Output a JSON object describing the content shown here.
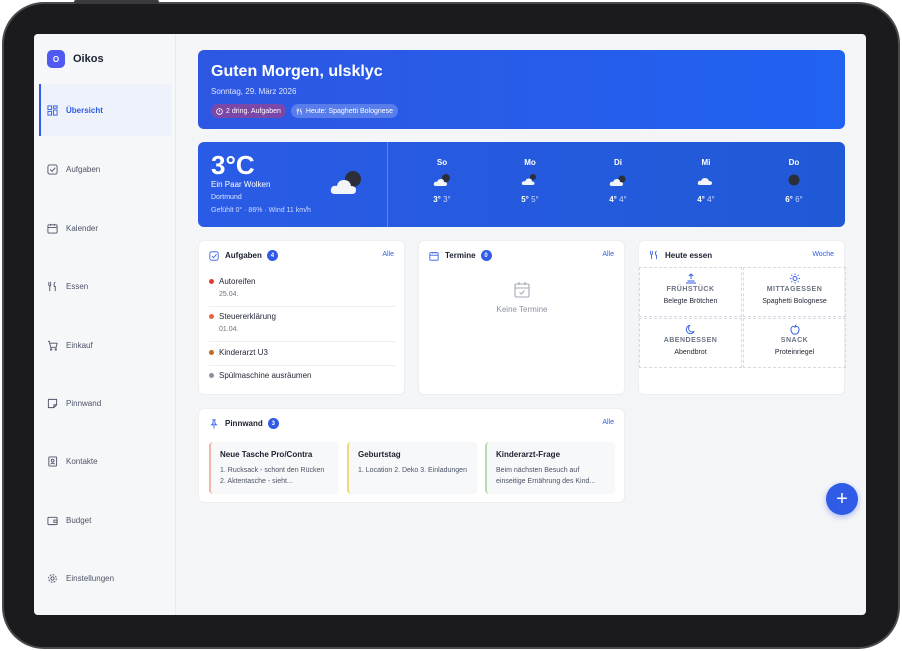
{
  "app": {
    "name": "Oikos",
    "logo_letter": "O"
  },
  "sidebar": {
    "items": [
      {
        "label": "Übersicht",
        "icon": "dashboard-icon",
        "active": true
      },
      {
        "label": "Aufgaben",
        "icon": "checkbox-icon"
      },
      {
        "label": "Kalender",
        "icon": "calendar-icon"
      },
      {
        "label": "Essen",
        "icon": "cutlery-icon"
      },
      {
        "label": "Einkauf",
        "icon": "cart-icon"
      },
      {
        "label": "Pinnwand",
        "icon": "sticky-note-icon"
      },
      {
        "label": "Kontakte",
        "icon": "contacts-icon"
      },
      {
        "label": "Budget",
        "icon": "wallet-icon"
      },
      {
        "label": "Einstellungen",
        "icon": "gear-icon"
      }
    ]
  },
  "hero": {
    "greeting": "Guten Morgen, ulsklyc",
    "date": "Sonntag, 29. März 2026",
    "urgent_chip": "2 dring. Aufgaben",
    "food_chip": "Heute: Spaghetti Bolognese"
  },
  "weather": {
    "temp": "3°C",
    "description": "Ein Paar Wolken",
    "location": "Dortmund",
    "details": "Gefühlt 0° · 86% · Wind 11 km/h",
    "forecast": [
      {
        "day": "So",
        "hi": "3°",
        "lo": "3°",
        "icon": "cloud-night-icon"
      },
      {
        "day": "Mo",
        "hi": "5°",
        "lo": "5°",
        "icon": "cloud-night-icon"
      },
      {
        "day": "Di",
        "hi": "4°",
        "lo": "4°",
        "icon": "cloud-night-icon"
      },
      {
        "day": "Mi",
        "hi": "4°",
        "lo": "4°",
        "icon": "cloud-icon"
      },
      {
        "day": "Do",
        "hi": "6°",
        "lo": "6°",
        "icon": "moon-icon"
      }
    ]
  },
  "tasks": {
    "title": "Aufgaben",
    "count": "4",
    "link": "Alle",
    "items": [
      {
        "label": "Autoreifen",
        "date": "25.04.",
        "color": "#e53935"
      },
      {
        "label": "Steuererklärung",
        "date": "01.04.",
        "color": "#e8643c"
      },
      {
        "label": "Kinderarzt U3",
        "date": "",
        "color": "#c06a1c"
      },
      {
        "label": "Spülmaschine ausräumen",
        "date": "",
        "color": "#8a90a0"
      }
    ]
  },
  "appointments": {
    "title": "Termine",
    "count": "0",
    "link": "Alle",
    "empty": "Keine Termine"
  },
  "meals": {
    "title": "Heute essen",
    "link": "Woche",
    "items": [
      {
        "label": "FRÜHSTÜCK",
        "dish": "Belegte Brötchen",
        "icon": "sunrise-icon"
      },
      {
        "label": "MITTAGESSEN",
        "dish": "Spaghetti Bolognese",
        "icon": "sun-icon"
      },
      {
        "label": "ABENDESSEN",
        "dish": "Abendbrot",
        "icon": "moon-icon"
      },
      {
        "label": "SNACK",
        "dish": "Proteinriegel",
        "icon": "apple-icon"
      }
    ]
  },
  "pinboard": {
    "title": "Pinnwand",
    "count": "3",
    "link": "Alle",
    "notes": [
      {
        "title": "Neue Tasche Pro/Contra",
        "text": "1. Rucksack - schont den Rücken 2. Aktentasche - sieht...",
        "color": "#f2b4a8"
      },
      {
        "title": "Geburtstag",
        "text": "1. Location 2. Deko 3. Einladungen",
        "color": "#f0d87a"
      },
      {
        "title": "Kinderarzt-Frage",
        "text": "Beim nächsten Besuch auf einseitige Ernährung des Kind...",
        "color": "#b8dcae"
      }
    ]
  },
  "fab": {
    "label": "+"
  },
  "colors": {
    "accent": "#2f5be6",
    "background": "#f4f5f7"
  }
}
